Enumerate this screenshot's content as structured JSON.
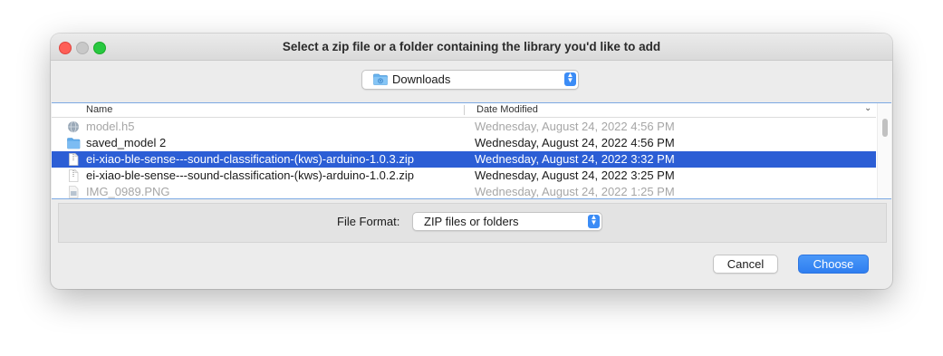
{
  "window": {
    "title": "Select a zip file or a folder containing the library you'd like to add",
    "traffic_lights": {
      "close": "#fe5f57",
      "minimize": "#c8c8c8",
      "maximize": "#28c840"
    }
  },
  "location": {
    "label": "Downloads",
    "icon": "folder-icon"
  },
  "columns": {
    "name": "Name",
    "date": "Date Modified"
  },
  "files": [
    {
      "name": "model.h5",
      "date": "Wednesday, August 24, 2022 4:56 PM",
      "icon": "model-file-icon",
      "state": "disabled"
    },
    {
      "name": "saved_model 2",
      "date": "Wednesday, August 24, 2022 4:56 PM",
      "icon": "folder-icon",
      "state": "enabled"
    },
    {
      "name": "ei-xiao-ble-sense---sound-classification-(kws)-arduino-1.0.3.zip",
      "date": "Wednesday, August 24, 2022 3:32 PM",
      "icon": "zip-file-icon",
      "state": "selected"
    },
    {
      "name": "ei-xiao-ble-sense---sound-classification-(kws)-arduino-1.0.2.zip",
      "date": "Wednesday, August 24, 2022 3:25 PM",
      "icon": "zip-file-icon",
      "state": "enabled"
    },
    {
      "name": "IMG_0989.PNG",
      "date": "Wednesday, August 24, 2022 1:25 PM",
      "icon": "image-file-icon",
      "state": "disabled"
    }
  ],
  "file_format": {
    "label": "File Format:",
    "value": "ZIP files or folders"
  },
  "buttons": {
    "cancel": "Cancel",
    "choose": "Choose"
  },
  "colors": {
    "accent": "#2f7ef0",
    "selection": "#2c5ed5"
  }
}
